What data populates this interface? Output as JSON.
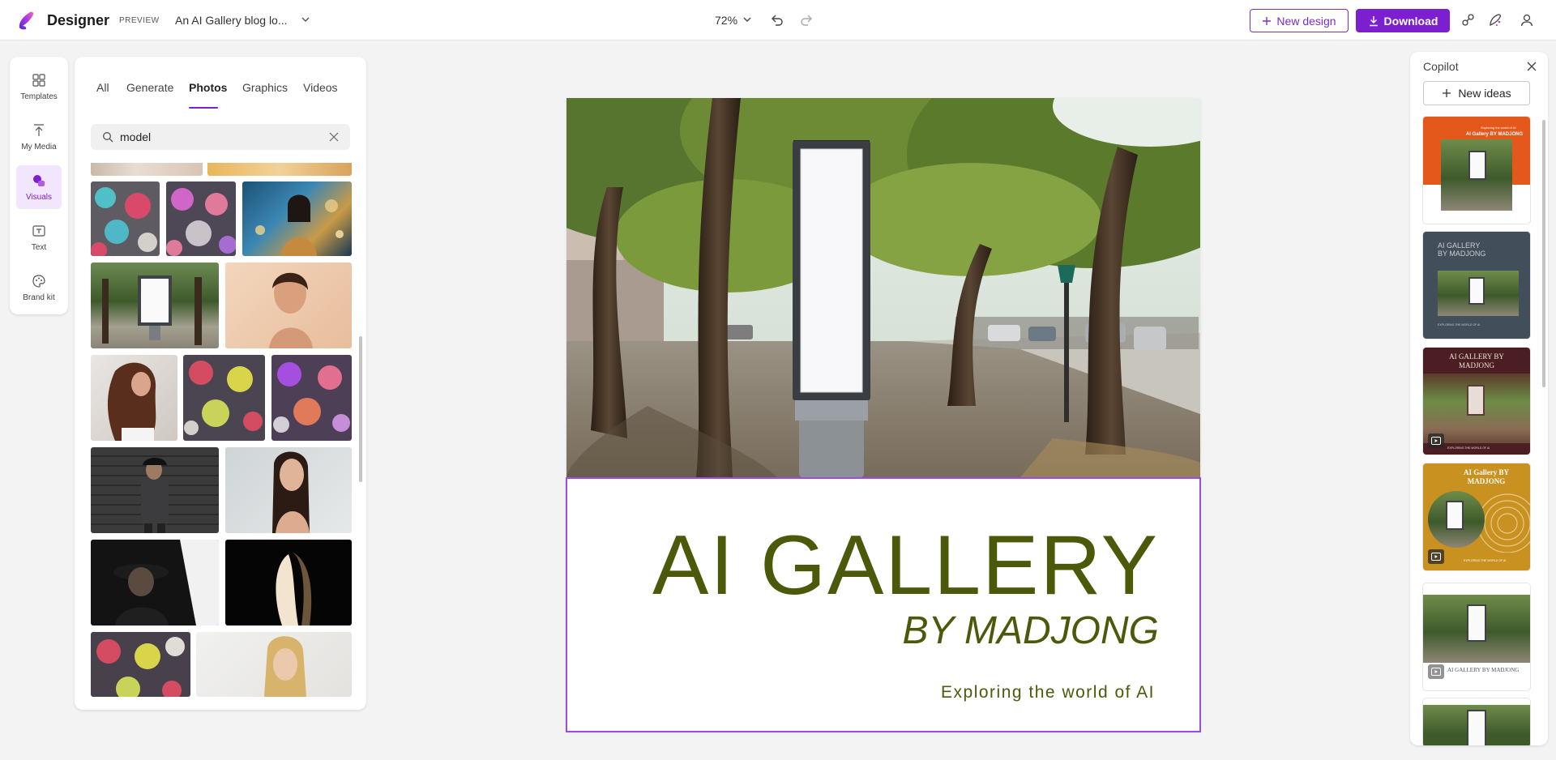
{
  "header": {
    "app_name": "Designer",
    "preview_label": "PREVIEW",
    "doc_title": "An AI Gallery blog lo...",
    "zoom": "72%",
    "new_design_label": "New design",
    "download_label": "Download",
    "accent_color": "#7b1fcf"
  },
  "rail": {
    "items": [
      {
        "label": "Templates",
        "icon": "templates-icon"
      },
      {
        "label": "My Media",
        "icon": "upload-icon"
      },
      {
        "label": "Visuals",
        "icon": "visuals-icon",
        "active": true
      },
      {
        "label": "Text",
        "icon": "text-icon"
      },
      {
        "label": "Brand kit",
        "icon": "brand-kit-icon"
      }
    ]
  },
  "media_panel": {
    "tabs": [
      {
        "label": "All"
      },
      {
        "label": "Generate"
      },
      {
        "label": "Photos",
        "active": true
      },
      {
        "label": "Graphics"
      },
      {
        "label": "Videos"
      }
    ],
    "search": {
      "value": "model",
      "placeholder": "Search"
    }
  },
  "canvas": {
    "headline": "AI GALLERY",
    "byline": "BY MADJONG",
    "tagline": "Exploring the world of AI",
    "text_color": "#4a5a0a"
  },
  "copilot": {
    "title": "Copilot",
    "new_ideas_label": "New ideas",
    "cards": [
      {
        "style": "orange",
        "top_small": "Exploring the world of AI",
        "title": "AI Gallery BY MADJONG"
      },
      {
        "style": "slate",
        "title": "AI GALLERY BY MADJONG",
        "bottom": "EXPLORING THE WORLD OF AI"
      },
      {
        "style": "maroon",
        "title": "AI GALLERY BY MADJONG",
        "bottom": "EXPLORING THE WORLD OF AI"
      },
      {
        "style": "mustard",
        "title": "AI Gallery BY MADJONG",
        "bottom": "EXPLORING THE WORLD OF AI"
      },
      {
        "style": "white",
        "title": "AI GALLERY BY MADJONG"
      }
    ]
  }
}
